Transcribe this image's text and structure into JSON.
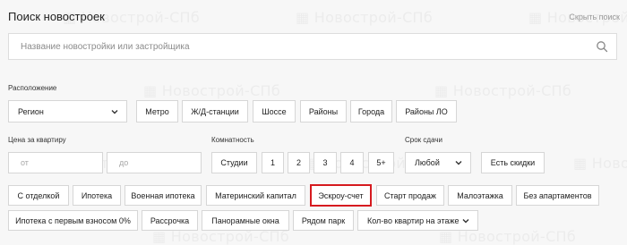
{
  "header": {
    "title": "Поиск новостроек",
    "hide_link": "Скрыть поиск"
  },
  "search": {
    "placeholder": "Название новостройки или застройщика",
    "icon": "search-icon"
  },
  "location": {
    "label": "Расположение",
    "region_select": "Регион",
    "buttons": [
      "Метро",
      "Ж/Д-станции",
      "Шоссе",
      "Районы",
      "Города",
      "Районы ЛО"
    ]
  },
  "price": {
    "label": "Цена за квартиру",
    "from_placeholder": "от",
    "to_placeholder": "до"
  },
  "rooms": {
    "label": "Комнатность",
    "buttons": [
      "Студии",
      "1",
      "2",
      "3",
      "4",
      "5+"
    ]
  },
  "deadline": {
    "label": "Срок сдачи",
    "select": "Любой",
    "discounts_button": "Есть скидки"
  },
  "filters": {
    "row1": [
      "С отделкой",
      "Ипотека",
      "Военная ипотека",
      "Материнский капитал",
      "Эскроу-счет",
      "Старт продаж",
      "Малоэтажка",
      "Без апартаментов"
    ],
    "row2": [
      "Ипотека с первым взносом 0%",
      "Рассрочка",
      "Панорамные окна",
      "Рядом парк"
    ],
    "floor_select": "Кол-во квартир на этаже",
    "highlighted": "Эскроу-счет",
    "highlight_color": "#d61a1f"
  }
}
